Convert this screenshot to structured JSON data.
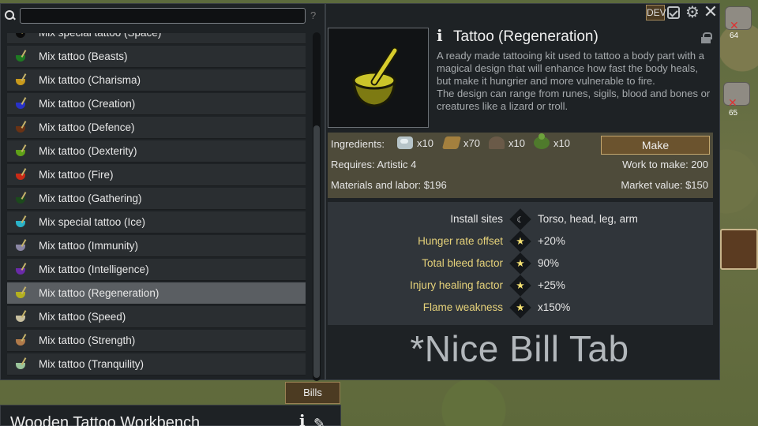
{
  "search": {
    "placeholder": "",
    "value": "",
    "help": "?"
  },
  "recipes": [
    {
      "label": "Mix special tattoo (Space)",
      "color": "#0b0b0b",
      "selected": false
    },
    {
      "label": "Mix tattoo (Beasts)",
      "color": "#1e7a22",
      "selected": false
    },
    {
      "label": "Mix tattoo (Charisma)",
      "color": "#c99a1c",
      "selected": false
    },
    {
      "label": "Mix tattoo (Creation)",
      "color": "#2832c6",
      "selected": false
    },
    {
      "label": "Mix tattoo (Defence)",
      "color": "#6a3214",
      "selected": false
    },
    {
      "label": "Mix tattoo (Dexterity)",
      "color": "#5fa018",
      "selected": false
    },
    {
      "label": "Mix tattoo (Fire)",
      "color": "#c82a16",
      "selected": false
    },
    {
      "label": "Mix tattoo (Gathering)",
      "color": "#1c4a1c",
      "selected": false
    },
    {
      "label": "Mix special tattoo (Ice)",
      "color": "#2ab2c8",
      "selected": false
    },
    {
      "label": "Mix tattoo (Immunity)",
      "color": "#8a86a4",
      "selected": false
    },
    {
      "label": "Mix tattoo (Intelligence)",
      "color": "#6a2aa8",
      "selected": false
    },
    {
      "label": "Mix tattoo (Regeneration)",
      "color": "#b4b01e",
      "selected": true
    },
    {
      "label": "Mix tattoo (Speed)",
      "color": "#c8c0a0",
      "selected": false
    },
    {
      "label": "Mix tattoo (Strength)",
      "color": "#b07a4a",
      "selected": false
    },
    {
      "label": "Mix tattoo (Tranquility)",
      "color": "#9ac49a",
      "selected": false
    }
  ],
  "header": {
    "dev_label": "DEV"
  },
  "product": {
    "title": "Tattoo (Regeneration)",
    "description_1": "A ready made tattooing kit used to tattoo a body part with a magical design that will enhance how fast the body heals, but make it hungrier and more vulnerable to fire.",
    "description_2": "The design can range from runes, sigils, blood and bones or creatures like a lizard or troll."
  },
  "costs": {
    "ingredients_label": "Ingredients:",
    "ingredients": [
      {
        "icon": "cloth-icon",
        "qty": "x10"
      },
      {
        "icon": "wood-icon",
        "qty": "x70"
      },
      {
        "icon": "rock-icon",
        "qty": "x10"
      },
      {
        "icon": "herb-icon",
        "qty": "x10"
      }
    ],
    "make_label": "Make",
    "requires": "Requires: Artistic 4",
    "work": "Work to make: 200",
    "materials": "Materials and labor: $196",
    "market": "Market value: $150"
  },
  "stats": [
    {
      "label": "Install sites",
      "value": "Torso, head, leg, arm",
      "style": "plain",
      "icon": "body-icon"
    },
    {
      "label": "Hunger rate offset",
      "value": "+20%",
      "style": "gold",
      "icon": "star-icon"
    },
    {
      "label": "Total bleed factor",
      "value": "90%",
      "style": "gold",
      "icon": "star-icon"
    },
    {
      "label": "Injury healing factor",
      "value": "+25%",
      "style": "gold",
      "icon": "star-icon"
    },
    {
      "label": "Flame weakness",
      "value": "x150%",
      "style": "gold",
      "icon": "star-icon"
    }
  ],
  "watermark": "*Nice Bill Tab",
  "tabs": {
    "bills": "Bills"
  },
  "workbench": {
    "title": "Wooden Tattoo Workbench"
  },
  "world": {
    "counts": [
      "64",
      "65"
    ]
  }
}
